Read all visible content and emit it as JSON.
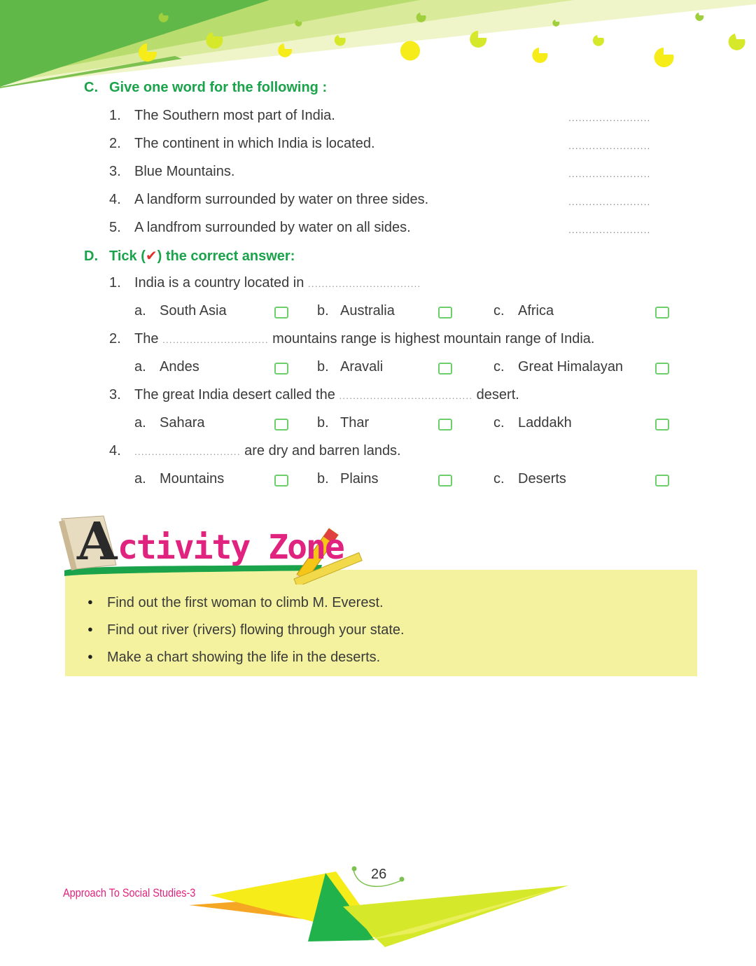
{
  "section_c": {
    "letter": "C.",
    "title": "Give one word for the following :",
    "items": [
      {
        "num": "1.",
        "text": "The Southern most part of India.",
        "blank": "........................"
      },
      {
        "num": "2.",
        "text": "The continent in which India is located.",
        "blank": "........................"
      },
      {
        "num": "3.",
        "text": "Blue Mountains.",
        "blank": "........................"
      },
      {
        "num": "4.",
        "text": "A landform surrounded by water on three sides.",
        "blank": "........................"
      },
      {
        "num": "5.",
        "text": "A landfrom surrounded by water on all sides.",
        "blank": "........................"
      }
    ]
  },
  "section_d": {
    "letter": "D.",
    "title_pre": "Tick (",
    "tick": "✔",
    "title_post": ") the correct answer:",
    "questions": [
      {
        "num": "1.",
        "pre": "India is a country located in ",
        "blank": ".................................",
        "post": "",
        "options": [
          {
            "letter": "a.",
            "text": "South Asia"
          },
          {
            "letter": "b.",
            "text": "Australia"
          },
          {
            "letter": "c.",
            "text": "Africa"
          }
        ]
      },
      {
        "num": "2.",
        "pre": "The ",
        "blank": "...............................",
        "post": " mountains range is highest mountain range of India.",
        "options": [
          {
            "letter": "a.",
            "text": "Andes"
          },
          {
            "letter": "b.",
            "text": "Aravali"
          },
          {
            "letter": "c.",
            "text": "Great Himalayan"
          }
        ]
      },
      {
        "num": "3.",
        "pre": "The great India desert called the ",
        "blank": ".......................................",
        "post": " desert.",
        "options": [
          {
            "letter": "a.",
            "text": "Sahara"
          },
          {
            "letter": "b.",
            "text": "Thar"
          },
          {
            "letter": "c.",
            "text": "Laddakh"
          }
        ]
      },
      {
        "num": "4.",
        "pre": "",
        "blank": "...............................",
        "post": " are dry and barren lands.",
        "options": [
          {
            "letter": "a.",
            "text": "Mountains"
          },
          {
            "letter": "b.",
            "text": "Plains"
          },
          {
            "letter": "c.",
            "text": "Deserts"
          }
        ]
      }
    ]
  },
  "activity_zone": {
    "title_big_letter": "A",
    "title_rest": "ctivity Zone",
    "items": [
      "Find out the first woman to climb M. Everest.",
      "Find out river (rivers) flowing through your state.",
      "Make a chart showing the life in the deserts."
    ]
  },
  "footer": {
    "book_title": "Approach To Social Studies-3",
    "page_number": "26"
  },
  "colors": {
    "heading_green": "#1aa34a",
    "tick_red": "#e0302a",
    "zone_yellow": "#f4f29e",
    "zone_pink": "#e0237e",
    "checkbox_green": "#6ccf6c"
  }
}
